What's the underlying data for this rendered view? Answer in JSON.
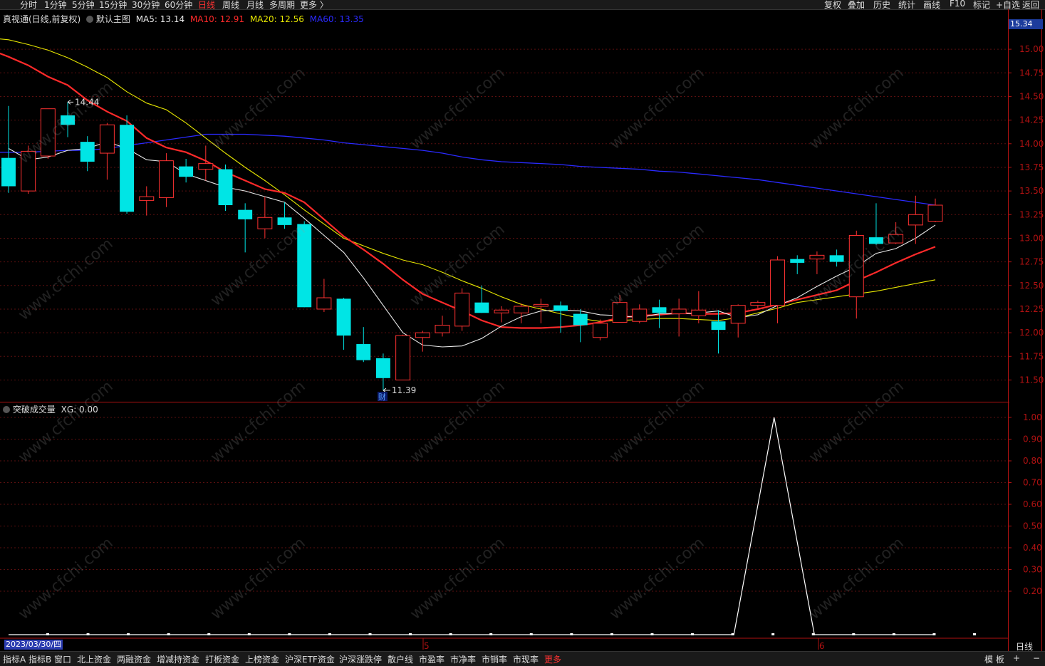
{
  "topbar": {
    "periods": [
      "分时",
      "1分钟",
      "5分钟",
      "15分钟",
      "30分钟",
      "60分钟",
      "日线",
      "周线",
      "月线",
      "多周期",
      "更多 〉"
    ],
    "active_period": "日线",
    "right_tools": [
      "复权",
      "叠加",
      "历史",
      "统计",
      "画线",
      "F10",
      "标记",
      "+自选",
      "返回"
    ]
  },
  "main_legend": {
    "title": "真视通(日线,前复权)",
    "template": "默认主图",
    "ma5": "MA5: 13.14",
    "ma10": "MA10: 12.91",
    "ma20": "MA20: 12.56",
    "ma60": "MA60: 13.35"
  },
  "sub_legend": {
    "name": "突破成交量",
    "value": "XG: 0.00"
  },
  "price_tag": "15.34",
  "date_tag": "2023/03/30/四",
  "period_tag": "日线",
  "bottombar": {
    "tabs": [
      "指标A",
      "指标B",
      "窗口",
      "北上资金",
      "两融资金",
      "增减持资金",
      "打板资金",
      "上榜资金",
      "沪深ETF资金",
      "沪深涨跌停",
      "散户线",
      "市盈率",
      "市净率",
      "市销率",
      "市现率",
      "更多"
    ],
    "right": [
      "模 板",
      "+",
      "−"
    ]
  },
  "colors": {
    "up": "#ff3232",
    "down": "#00e5e5",
    "ma5": "#e8e8e8",
    "ma10": "#ff2a2a",
    "ma20": "#e6e600",
    "ma60": "#2a2aff",
    "volume_line": "#ffffff"
  },
  "chart_data": [
    {
      "type": "candlestick",
      "title": "真视通(日线,前复权)",
      "ylim": [
        11.3,
        15.34
      ],
      "y_ticks": [
        11.5,
        11.75,
        12.0,
        12.25,
        12.5,
        12.75,
        13.0,
        13.25,
        13.5,
        13.75,
        14.0,
        14.25,
        14.5,
        14.75,
        15.0
      ],
      "x_ticks": [
        "5",
        "6"
      ],
      "annotations": [
        {
          "text": "14.44",
          "type": "high-marker"
        },
        {
          "text": "11.39",
          "type": "low-marker"
        },
        {
          "text": "财",
          "type": "event-marker"
        }
      ],
      "candles": [
        {
          "o": 13.85,
          "h": 14.4,
          "l": 13.48,
          "c": 13.55
        },
        {
          "o": 13.5,
          "h": 13.98,
          "l": 13.47,
          "c": 13.92
        },
        {
          "o": 13.87,
          "h": 14.37,
          "l": 13.84,
          "c": 14.37
        },
        {
          "o": 14.3,
          "h": 14.44,
          "l": 14.07,
          "c": 14.2
        },
        {
          "o": 14.02,
          "h": 14.08,
          "l": 13.71,
          "c": 13.81
        },
        {
          "o": 13.9,
          "h": 14.22,
          "l": 13.62,
          "c": 14.2
        },
        {
          "o": 14.2,
          "h": 14.3,
          "l": 13.26,
          "c": 13.28
        },
        {
          "o": 13.4,
          "h": 13.55,
          "l": 13.24,
          "c": 13.44
        },
        {
          "o": 13.43,
          "h": 13.9,
          "l": 13.33,
          "c": 13.82
        },
        {
          "o": 13.76,
          "h": 13.84,
          "l": 13.59,
          "c": 13.65
        },
        {
          "o": 13.73,
          "h": 13.98,
          "l": 13.61,
          "c": 13.79
        },
        {
          "o": 13.73,
          "h": 13.78,
          "l": 13.29,
          "c": 13.35
        },
        {
          "o": 13.3,
          "h": 13.37,
          "l": 12.85,
          "c": 13.2
        },
        {
          "o": 13.1,
          "h": 13.44,
          "l": 13.0,
          "c": 13.22
        },
        {
          "o": 13.22,
          "h": 13.38,
          "l": 13.1,
          "c": 13.14
        },
        {
          "o": 13.15,
          "h": 13.18,
          "l": 12.27,
          "c": 12.27
        },
        {
          "o": 12.25,
          "h": 12.57,
          "l": 12.22,
          "c": 12.37
        },
        {
          "o": 12.36,
          "h": 12.37,
          "l": 11.82,
          "c": 11.97
        },
        {
          "o": 11.88,
          "h": 12.06,
          "l": 11.69,
          "c": 11.71
        },
        {
          "o": 11.73,
          "h": 11.78,
          "l": 11.39,
          "c": 11.52
        },
        {
          "o": 11.5,
          "h": 11.98,
          "l": 11.5,
          "c": 11.97
        },
        {
          "o": 11.95,
          "h": 12.02,
          "l": 11.8,
          "c": 12.0
        },
        {
          "o": 12.0,
          "h": 12.18,
          "l": 11.96,
          "c": 12.08
        },
        {
          "o": 12.07,
          "h": 12.47,
          "l": 12.02,
          "c": 12.42
        },
        {
          "o": 12.32,
          "h": 12.5,
          "l": 12.21,
          "c": 12.21
        },
        {
          "o": 12.21,
          "h": 12.28,
          "l": 12.11,
          "c": 12.24
        },
        {
          "o": 12.21,
          "h": 12.31,
          "l": 12.1,
          "c": 12.28
        },
        {
          "o": 12.28,
          "h": 12.36,
          "l": 12.1,
          "c": 12.3
        },
        {
          "o": 12.29,
          "h": 12.33,
          "l": 12.0,
          "c": 12.23
        },
        {
          "o": 12.2,
          "h": 12.25,
          "l": 11.9,
          "c": 12.08
        },
        {
          "o": 11.95,
          "h": 12.14,
          "l": 11.92,
          "c": 12.1
        },
        {
          "o": 12.11,
          "h": 12.4,
          "l": 12.11,
          "c": 12.32
        },
        {
          "o": 12.12,
          "h": 12.3,
          "l": 12.1,
          "c": 12.25
        },
        {
          "o": 12.27,
          "h": 12.35,
          "l": 12.05,
          "c": 12.21
        },
        {
          "o": 12.2,
          "h": 12.36,
          "l": 11.96,
          "c": 12.25
        },
        {
          "o": 12.18,
          "h": 12.44,
          "l": 12.1,
          "c": 12.24
        },
        {
          "o": 12.12,
          "h": 12.24,
          "l": 11.78,
          "c": 12.03
        },
        {
          "o": 12.1,
          "h": 12.3,
          "l": 11.95,
          "c": 12.29
        },
        {
          "o": 12.29,
          "h": 12.34,
          "l": 12.26,
          "c": 12.32
        },
        {
          "o": 12.29,
          "h": 12.81,
          "l": 12.1,
          "c": 12.77
        },
        {
          "o": 12.78,
          "h": 12.82,
          "l": 12.62,
          "c": 12.74
        },
        {
          "o": 12.78,
          "h": 12.86,
          "l": 12.62,
          "c": 12.82
        },
        {
          "o": 12.82,
          "h": 12.88,
          "l": 12.7,
          "c": 12.75
        },
        {
          "o": 12.38,
          "h": 13.08,
          "l": 12.15,
          "c": 13.03
        },
        {
          "o": 13.01,
          "h": 13.37,
          "l": 12.93,
          "c": 12.94
        },
        {
          "o": 12.95,
          "h": 13.17,
          "l": 12.94,
          "c": 13.04
        },
        {
          "o": 13.14,
          "h": 13.45,
          "l": 12.94,
          "c": 13.25
        },
        {
          "o": 13.18,
          "h": 13.42,
          "l": 13.17,
          "c": 13.35
        }
      ],
      "ma5": [
        13.95,
        13.83,
        13.86,
        13.93,
        13.95,
        14.02,
        13.95,
        13.83,
        13.81,
        13.68,
        13.61,
        13.54,
        13.5,
        13.44,
        13.38,
        13.21,
        13.03,
        12.85,
        12.58,
        12.29,
        12.0,
        11.87,
        11.85,
        11.86,
        11.94,
        12.07,
        12.17,
        12.23,
        12.24,
        12.23,
        12.19,
        12.18,
        12.16,
        12.2,
        12.2,
        12.21,
        12.23,
        12.16,
        12.19,
        12.29,
        12.37,
        12.49,
        12.6,
        12.7,
        12.84,
        12.89,
        13.0,
        13.14
      ],
      "ma10": [
        15.07,
        15.0,
        14.92,
        14.83,
        14.71,
        14.62,
        14.46,
        14.34,
        14.24,
        14.06,
        13.96,
        13.91,
        13.82,
        13.7,
        13.61,
        13.52,
        13.48,
        13.38,
        13.2,
        13.02,
        12.88,
        12.73,
        12.56,
        12.41,
        12.32,
        12.23,
        12.13,
        12.06,
        12.05,
        12.05,
        12.06,
        12.08,
        12.11,
        12.16,
        12.18,
        12.19,
        12.21,
        12.2,
        12.2,
        12.21,
        12.25,
        12.3,
        12.35,
        12.4,
        12.45,
        12.55,
        12.64,
        12.74,
        12.83,
        12.91
      ],
      "ma20": [
        15.1,
        15.12,
        15.1,
        15.05,
        14.99,
        14.91,
        14.81,
        14.7,
        14.55,
        14.43,
        14.36,
        14.22,
        14.06,
        13.9,
        13.75,
        13.61,
        13.46,
        13.3,
        13.15,
        13.0,
        12.92,
        12.84,
        12.77,
        12.72,
        12.64,
        12.55,
        12.47,
        12.38,
        12.3,
        12.25,
        12.2,
        12.15,
        12.12,
        12.13,
        12.14,
        12.15,
        12.15,
        12.14,
        12.13,
        12.16,
        12.21,
        12.26,
        12.32,
        12.35,
        12.38,
        12.41,
        12.44,
        12.48,
        12.52,
        12.56
      ],
      "ma60": [
        13.88,
        13.91,
        13.91,
        13.91,
        13.92,
        13.93,
        13.93,
        13.95,
        13.98,
        14.01,
        14.04,
        14.07,
        14.1,
        14.1,
        14.1,
        14.09,
        14.08,
        14.06,
        14.04,
        14.01,
        13.99,
        13.97,
        13.95,
        13.93,
        13.9,
        13.86,
        13.83,
        13.81,
        13.8,
        13.79,
        13.78,
        13.76,
        13.75,
        13.74,
        13.73,
        13.71,
        13.7,
        13.68,
        13.66,
        13.64,
        13.62,
        13.59,
        13.56,
        13.53,
        13.5,
        13.47,
        13.44,
        13.41,
        13.38,
        13.35
      ]
    },
    {
      "type": "line",
      "title": "突破成交量",
      "ylim": [
        0,
        1.05
      ],
      "y_ticks": [
        0.2,
        0.3,
        0.4,
        0.5,
        0.6,
        0.7,
        0.8,
        0.9,
        1.0
      ],
      "series": [
        {
          "name": "XG",
          "values": [
            0,
            0,
            0,
            0,
            0,
            0,
            0,
            0,
            0,
            0,
            0,
            0,
            0,
            0,
            0,
            0,
            0,
            0,
            0,
            1,
            0,
            0,
            0,
            0
          ]
        }
      ]
    }
  ]
}
